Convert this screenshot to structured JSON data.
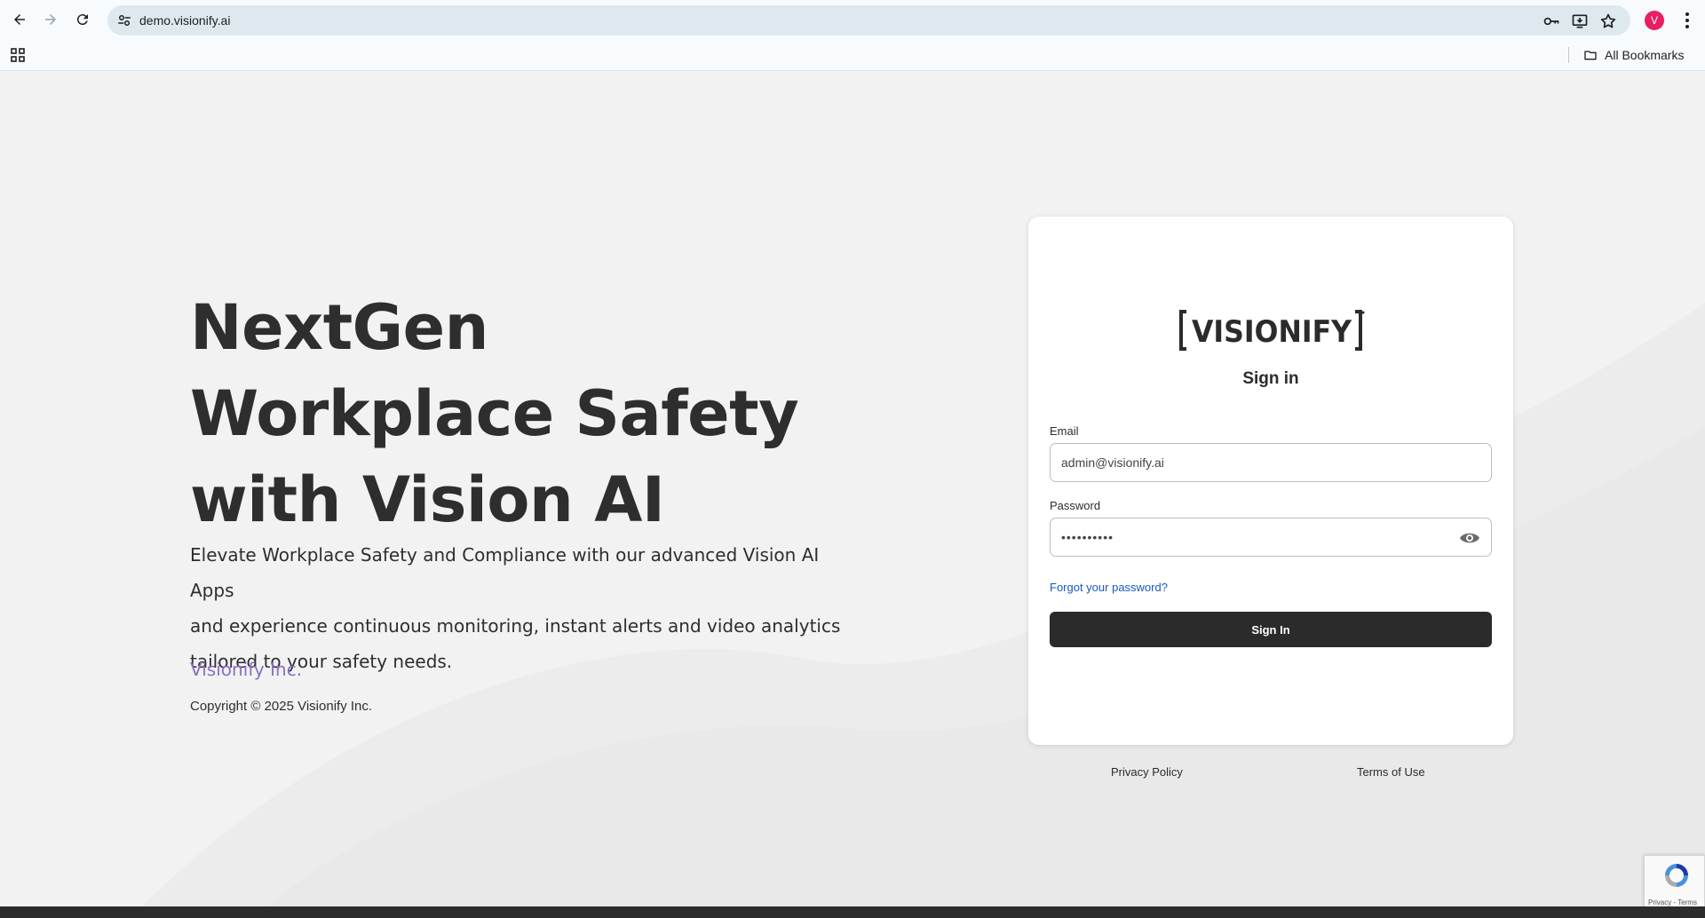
{
  "browser": {
    "url": "demo.visionify.ai",
    "avatar_letter": "V",
    "bookmarks_label": "All Bookmarks"
  },
  "hero": {
    "title_lines": [
      "NextGen",
      "Workplace Safety",
      "with Vision AI"
    ],
    "description_lines": [
      "Elevate Workplace Safety and Compliance with our advanced Vision AI Apps",
      "and experience continuous monitoring, instant alerts and video analytics",
      "tailored to your safety needs."
    ],
    "company": "Visionify Inc.",
    "copyright": "Copyright © 2025 Visionify Inc."
  },
  "login": {
    "logo_text": "VISIONIFY",
    "title": "Sign in",
    "email_label": "Email",
    "email_value": "admin@visionify.ai",
    "password_label": "Password",
    "password_value": "••••••••••",
    "forgot_label": "Forgot your password?",
    "submit_label": "Sign In"
  },
  "footer": {
    "privacy": "Privacy Policy",
    "terms": "Terms of Use"
  },
  "recaptcha": {
    "text": "Privacy - Terms"
  },
  "colors": {
    "accent_dark": "#2b2b2b",
    "link_blue": "#1a56c4",
    "company_purple": "#8a70c4",
    "avatar_pink": "#e91e63"
  }
}
